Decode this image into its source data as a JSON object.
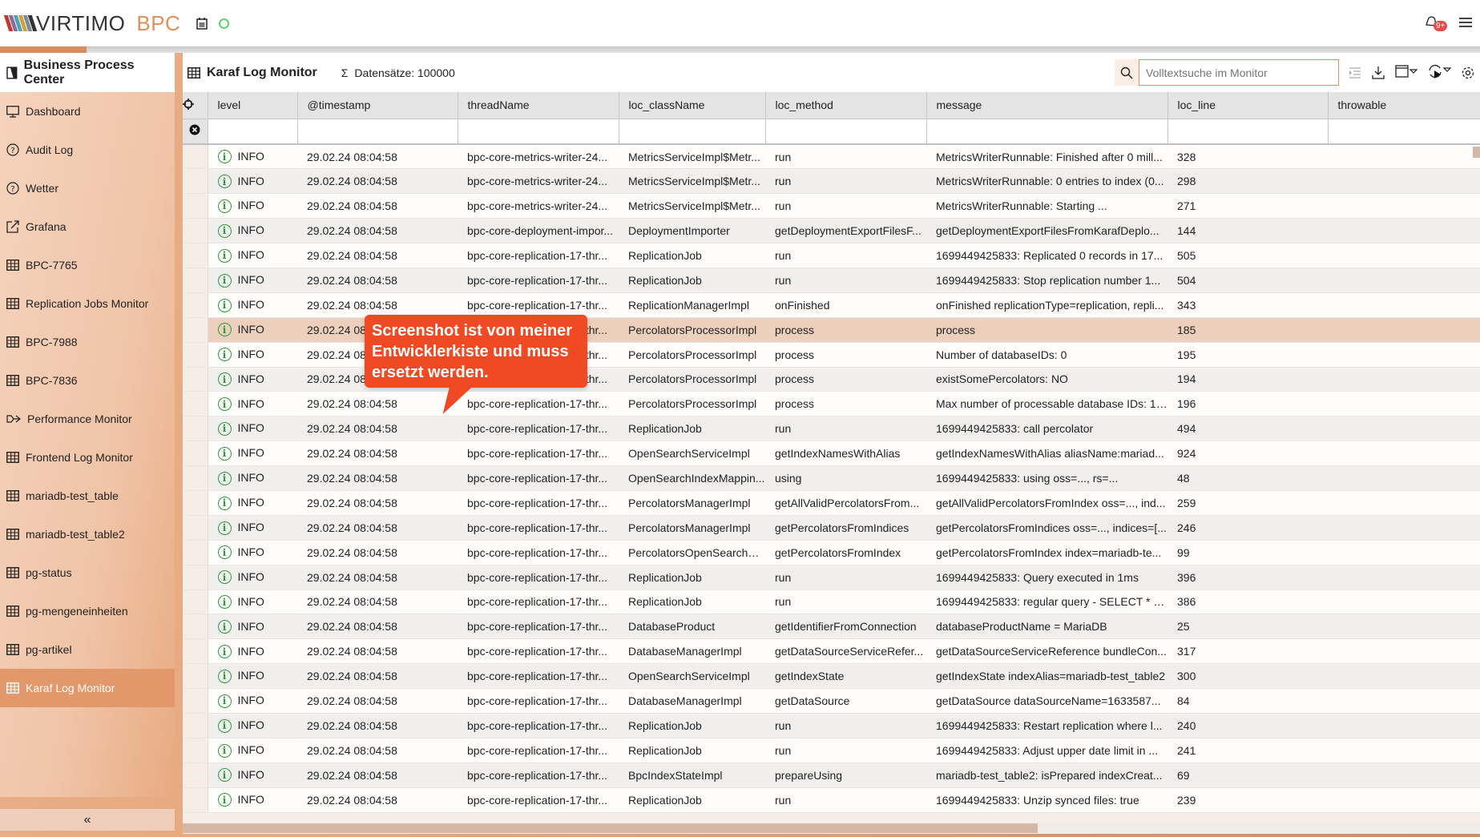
{
  "app": {
    "logo_text": "VIRTIMO",
    "logo_product": "BPC",
    "notification_count": "9+",
    "accent": "#e0915a"
  },
  "sidebar": {
    "title": "Business Process Center",
    "collapse_label": "«",
    "items": [
      {
        "label": "Dashboard",
        "icon": "monitor-icon"
      },
      {
        "label": "Audit Log",
        "icon": "question-circle-icon"
      },
      {
        "label": "Wetter",
        "icon": "question-circle-icon"
      },
      {
        "label": "Grafana",
        "icon": "external-link-icon"
      },
      {
        "label": "BPC-7765",
        "icon": "table-icon"
      },
      {
        "label": "Replication Jobs Monitor",
        "icon": "table-icon"
      },
      {
        "label": "BPC-7988",
        "icon": "table-icon"
      },
      {
        "label": "BPC-7836",
        "icon": "table-icon"
      },
      {
        "label": "Performance Monitor",
        "icon": "performance-icon"
      },
      {
        "label": "Frontend Log Monitor",
        "icon": "table-icon"
      },
      {
        "label": "mariadb-test_table",
        "icon": "table-icon"
      },
      {
        "label": "mariadb-test_table2",
        "icon": "table-icon"
      },
      {
        "label": "pg-status",
        "icon": "table-icon"
      },
      {
        "label": "pg-mengeneinheiten",
        "icon": "table-icon"
      },
      {
        "label": "pg-artikel",
        "icon": "table-icon"
      },
      {
        "label": "Karaf Log Monitor",
        "icon": "table-icon",
        "active": true
      }
    ]
  },
  "monitor": {
    "title": "Karaf Log Monitor",
    "count_label": "Datensätze: 100000",
    "search_placeholder": "Volltextsuche im Monitor",
    "columns": [
      "level",
      "@timestamp",
      "threadName",
      "loc_className",
      "loc_method",
      "message",
      "loc_line",
      "throwable"
    ],
    "highlighted_row": 7,
    "rows": [
      [
        "INFO",
        "29.02.24 08:04:58",
        "bpc-core-metrics-writer-24...",
        "MetricsServiceImpl$Metr...",
        "run",
        "MetricsWriterRunnable: Finished after 0 mill...",
        "328",
        ""
      ],
      [
        "INFO",
        "29.02.24 08:04:58",
        "bpc-core-metrics-writer-24...",
        "MetricsServiceImpl$Metr...",
        "run",
        "MetricsWriterRunnable: 0 entries to index (0...",
        "298",
        ""
      ],
      [
        "INFO",
        "29.02.24 08:04:58",
        "bpc-core-metrics-writer-24...",
        "MetricsServiceImpl$Metr...",
        "run",
        "MetricsWriterRunnable: Starting ...",
        "271",
        ""
      ],
      [
        "INFO",
        "29.02.24 08:04:58",
        "bpc-core-deployment-impor...",
        "DeploymentImporter",
        "getDeploymentExportFilesF...",
        "getDeploymentExportFilesFromKarafDeplo...",
        "144",
        ""
      ],
      [
        "INFO",
        "29.02.24 08:04:58",
        "bpc-core-replication-17-thr...",
        "ReplicationJob",
        "run",
        "1699449425833: Replicated 0 records in 17...",
        "505",
        ""
      ],
      [
        "INFO",
        "29.02.24 08:04:58",
        "bpc-core-replication-17-thr...",
        "ReplicationJob",
        "run",
        "1699449425833: Stop replication number 1...",
        "504",
        ""
      ],
      [
        "INFO",
        "29.02.24 08:04:58",
        "bpc-core-replication-17-thr...",
        "ReplicationManagerImpl",
        "onFinished",
        "onFinished replicationType=replication, repli...",
        "343",
        ""
      ],
      [
        "INFO",
        "29.02.24 08:04:58",
        "bpc-core-replication-17-thr...",
        "PercolatorsProcessorImpl",
        "process",
        "process",
        "185",
        ""
      ],
      [
        "INFO",
        "29.02.24 08:04:58",
        "bpc-core-replication-17-thr...",
        "PercolatorsProcessorImpl",
        "process",
        "Number of databaseIDs: 0",
        "195",
        ""
      ],
      [
        "INFO",
        "29.02.24 08:04:58",
        "bpc-core-replication-17-thr...",
        "PercolatorsProcessorImpl",
        "process",
        "existSomePercolators: NO",
        "194",
        ""
      ],
      [
        "INFO",
        "29.02.24 08:04:58",
        "bpc-core-replication-17-thr...",
        "PercolatorsProcessorImpl",
        "process",
        "Max number of processable database IDs: 10...",
        "196",
        ""
      ],
      [
        "INFO",
        "29.02.24 08:04:58",
        "bpc-core-replication-17-thr...",
        "ReplicationJob",
        "run",
        "1699449425833: call percolator",
        "494",
        ""
      ],
      [
        "INFO",
        "29.02.24 08:04:58",
        "bpc-core-replication-17-thr...",
        "OpenSearchServiceImpl",
        "getIndexNamesWithAlias",
        "getIndexNamesWithAlias aliasName:mariad...",
        "924",
        ""
      ],
      [
        "INFO",
        "29.02.24 08:04:58",
        "bpc-core-replication-17-thr...",
        "OpenSearchIndexMappin...",
        "using",
        "1699449425833: using oss=..., rs=...",
        "48",
        ""
      ],
      [
        "INFO",
        "29.02.24 08:04:58",
        "bpc-core-replication-17-thr...",
        "PercolatorsManagerImpl",
        "getAllValidPercolatorsFrom...",
        "getAllValidPercolatorsFromIndex oss=..., ind...",
        "259",
        ""
      ],
      [
        "INFO",
        "29.02.24 08:04:58",
        "bpc-core-replication-17-thr...",
        "PercolatorsManagerImpl",
        "getPercolatorsFromIndices",
        "getPercolatorsFromIndices oss=..., indices=[...",
        "246",
        ""
      ],
      [
        "INFO",
        "29.02.24 08:04:58",
        "bpc-core-replication-17-thr...",
        "PercolatorsOpenSearchH...",
        "getPercolatorsFromIndex",
        "getPercolatorsFromIndex index=mariadb-te...",
        "99",
        ""
      ],
      [
        "INFO",
        "29.02.24 08:04:58",
        "bpc-core-replication-17-thr...",
        "ReplicationJob",
        "run",
        "1699449425833: Query executed in 1ms",
        "396",
        ""
      ],
      [
        "INFO",
        "29.02.24 08:04:58",
        "bpc-core-replication-17-thr...",
        "ReplicationJob",
        "run",
        "1699449425833: regular query - SELECT * F...",
        "386",
        ""
      ],
      [
        "INFO",
        "29.02.24 08:04:58",
        "bpc-core-replication-17-thr...",
        "DatabaseProduct",
        "getIdentifierFromConnection",
        "databaseProductName = MariaDB",
        "25",
        ""
      ],
      [
        "INFO",
        "29.02.24 08:04:58",
        "bpc-core-replication-17-thr...",
        "DatabaseManagerImpl",
        "getDataSourceServiceRefer...",
        "getDataSourceServiceReference bundleCon...",
        "317",
        ""
      ],
      [
        "INFO",
        "29.02.24 08:04:58",
        "bpc-core-replication-17-thr...",
        "OpenSearchServiceImpl",
        "getIndexState",
        "getIndexState indexAlias=mariadb-test_table2",
        "300",
        ""
      ],
      [
        "INFO",
        "29.02.24 08:04:58",
        "bpc-core-replication-17-thr...",
        "DatabaseManagerImpl",
        "getDataSource",
        "getDataSource dataSourceName=1633587...",
        "84",
        ""
      ],
      [
        "INFO",
        "29.02.24 08:04:58",
        "bpc-core-replication-17-thr...",
        "ReplicationJob",
        "run",
        "1699449425833: Restart replication where l...",
        "240",
        ""
      ],
      [
        "INFO",
        "29.02.24 08:04:58",
        "bpc-core-replication-17-thr...",
        "ReplicationJob",
        "run",
        "1699449425833: Adjust upper date limit in ...",
        "241",
        ""
      ],
      [
        "INFO",
        "29.02.24 08:04:58",
        "bpc-core-replication-17-thr...",
        "BpcIndexStateImpl",
        "prepareUsing",
        "mariadb-test_table2: isPrepared indexCreat...",
        "69",
        ""
      ],
      [
        "INFO",
        "29.02.24 08:04:58",
        "bpc-core-replication-17-thr...",
        "ReplicationJob",
        "run",
        "1699449425833: Unzip synced files: true",
        "239",
        ""
      ]
    ]
  },
  "callout": {
    "text": "Screenshot ist von meiner Entwicklerkiste und muss ersetzt werden."
  }
}
